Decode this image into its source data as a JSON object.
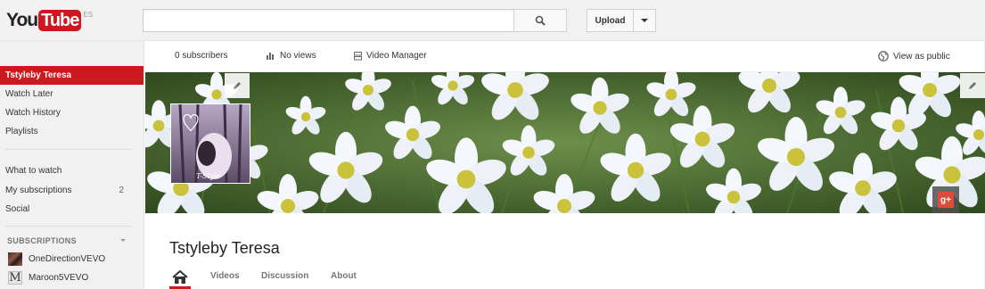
{
  "masthead": {
    "logo_you": "You",
    "logo_tube": "Tube",
    "region": "ES",
    "search_placeholder": "",
    "upload_label": "Upload"
  },
  "guide": {
    "items": [
      {
        "label": "Tstyleby Teresa",
        "active": true
      },
      {
        "label": "Watch Later"
      },
      {
        "label": "Watch History"
      },
      {
        "label": "Playlists"
      },
      {
        "label": "What to watch"
      },
      {
        "label": "My subscriptions",
        "count": "2"
      },
      {
        "label": "Social"
      }
    ],
    "subscriptions_heading": "SUBSCRIPTIONS",
    "subscriptions": [
      {
        "label": "OneDirectionVEVO"
      },
      {
        "label": "Maroon5VEVO",
        "thumb_letter": "M"
      }
    ]
  },
  "topbar": {
    "subscribers": "0 subscribers",
    "views": "No views",
    "video_manager": "Video Manager",
    "view_as_public": "View as public"
  },
  "avatar": {
    "caption": "T-Style"
  },
  "channel": {
    "title": "Tstyleby Teresa",
    "tabs": [
      "Videos",
      "Discussion",
      "About"
    ]
  },
  "colors": {
    "accent": "#cc181e",
    "gplus": "#dd4b39"
  },
  "icons": [
    "search-icon",
    "caret-down-icon",
    "bar-chart-icon",
    "video-manager-icon",
    "globe-icon",
    "pencil-icon",
    "google-plus-icon",
    "home-icon"
  ]
}
